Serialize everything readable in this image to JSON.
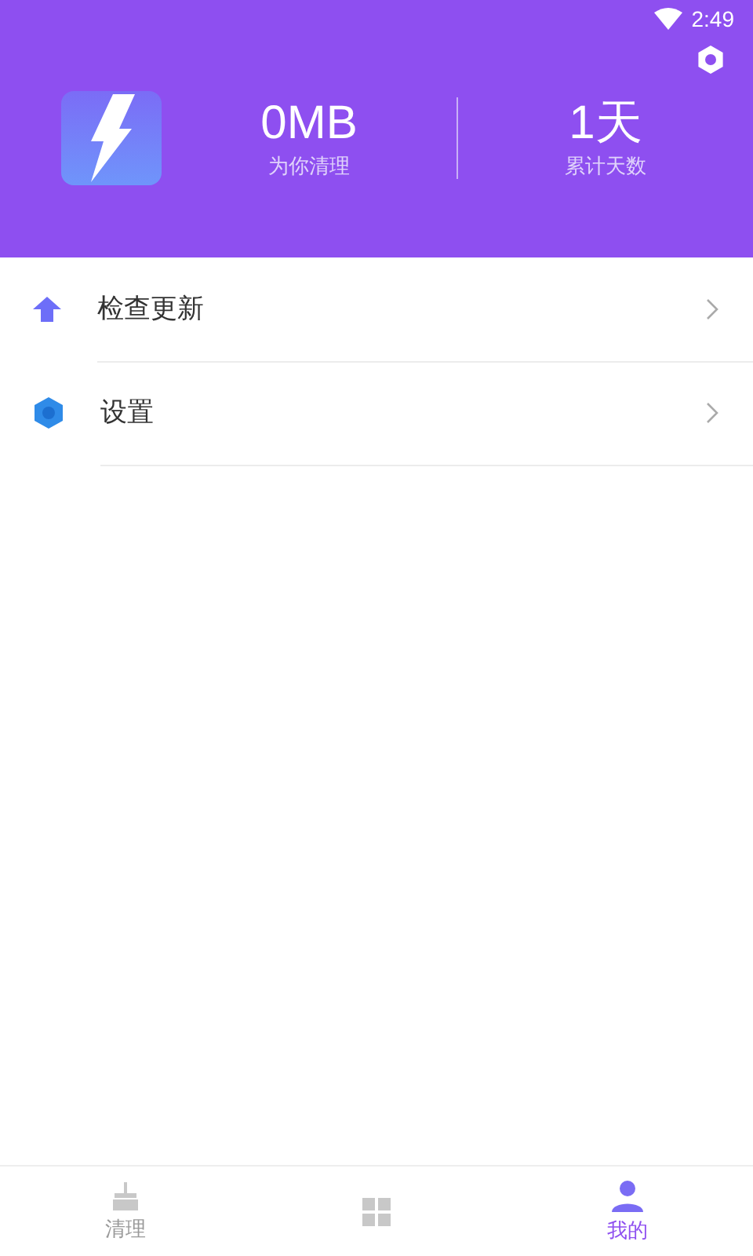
{
  "status_bar": {
    "time": "2:49"
  },
  "header": {
    "stats": [
      {
        "value": "0MB",
        "label": "为你清理"
      },
      {
        "value": "1天",
        "label": "累计天数"
      }
    ]
  },
  "menu": [
    {
      "kind": "update",
      "label": "检查更新"
    },
    {
      "kind": "settings",
      "label": "设置"
    }
  ],
  "bottom_nav": [
    {
      "kind": "clean",
      "label": "清理",
      "selected": false
    },
    {
      "kind": "tools",
      "selected": false
    },
    {
      "kind": "me",
      "label": "我的",
      "selected": true
    }
  ]
}
